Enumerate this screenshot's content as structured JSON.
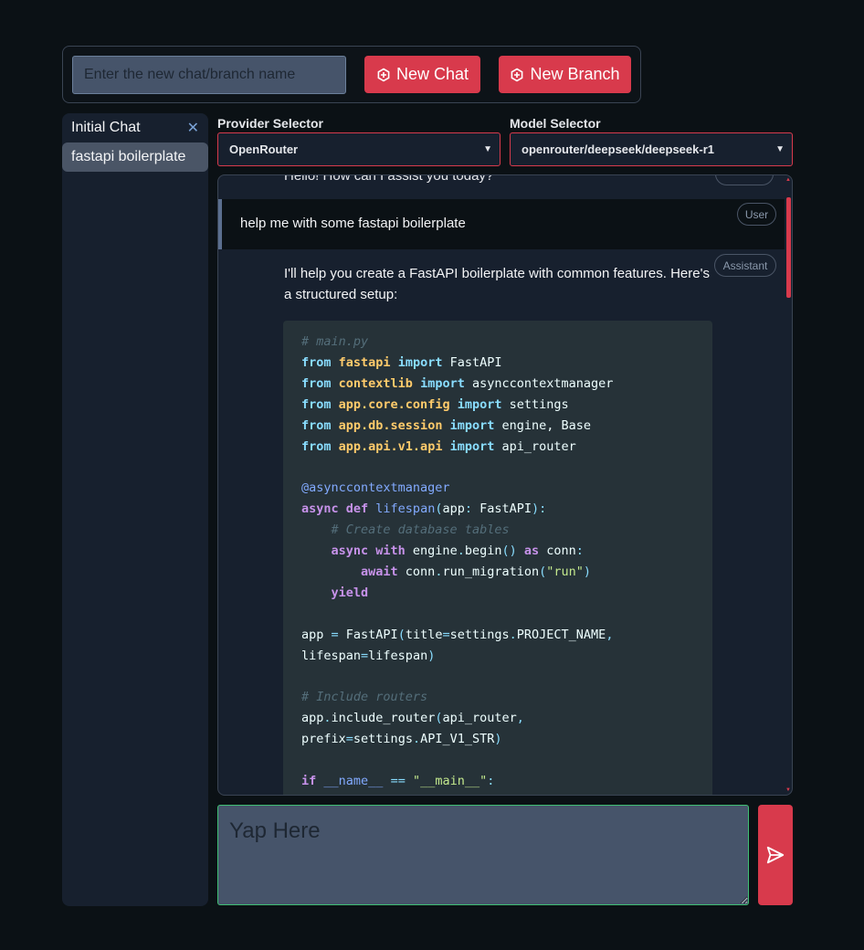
{
  "top_bar": {
    "name_input_placeholder": "Enter the new chat/branch name",
    "new_chat_label": "New Chat",
    "new_branch_label": "New Branch"
  },
  "sidebar": {
    "items": [
      {
        "label": "Initial Chat",
        "active": false,
        "closable": true
      },
      {
        "label": "fastapi boilerplate",
        "active": true,
        "closable": false
      }
    ]
  },
  "selectors": {
    "provider_label": "Provider Selector",
    "provider_value": "OpenRouter",
    "model_label": "Model Selector",
    "model_value": "openrouter/deepseek/deepseek-r1"
  },
  "chat": {
    "partial_message": "Hello! How can I assist you today?",
    "user_badge": "User",
    "assistant_badge": "Assistant",
    "user_message": "help me with some fastapi boilerplate",
    "assistant_intro": "I'll help you create a FastAPI boilerplate with common features. Here's a structured setup:"
  },
  "composer": {
    "placeholder": "Yap Here"
  },
  "colors": {
    "accent_red": "#d83a4c",
    "focus_green": "#3fbf74",
    "background": "#0b1115",
    "panel": "#17202e"
  },
  "icons": {
    "new_chat": "plus-circle-icon",
    "new_branch": "plus-circle-icon",
    "close": "close-icon",
    "send": "send-icon"
  }
}
